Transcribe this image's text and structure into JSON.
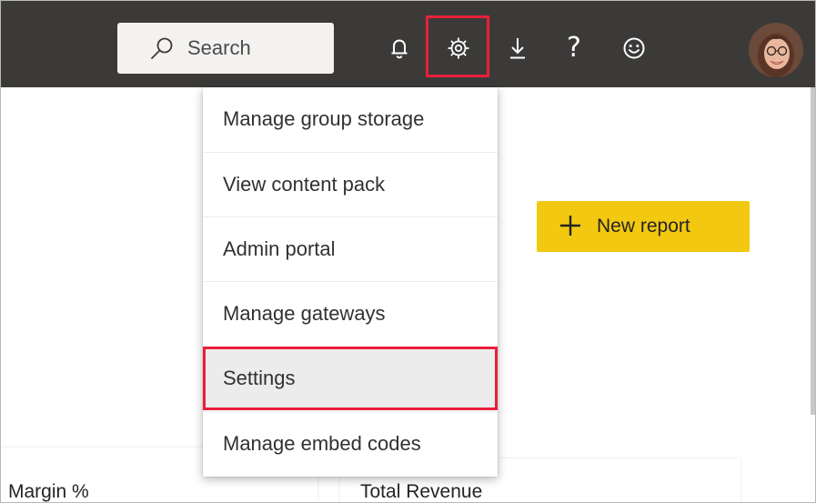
{
  "header": {
    "search": {
      "placeholder": "Search",
      "icon": "search-icon"
    },
    "icons": [
      {
        "name": "notifications-bell-icon"
      },
      {
        "name": "settings-gear-icon",
        "highlighted": true
      },
      {
        "name": "download-icon"
      },
      {
        "name": "help-icon",
        "glyph": "?"
      },
      {
        "name": "feedback-smiley-icon"
      }
    ],
    "avatar": "profile-avatar"
  },
  "settings_menu": {
    "items": [
      {
        "label": "Manage group storage"
      },
      {
        "label": "View content pack"
      },
      {
        "label": "Admin portal"
      },
      {
        "label": "Manage gateways"
      },
      {
        "label": "Settings",
        "highlighted": true
      },
      {
        "label": "Manage embed codes"
      }
    ]
  },
  "toolbar": {
    "new_report_label": "New report"
  },
  "cards": {
    "left_title": "Margin %",
    "right_title": "Total Revenue"
  },
  "colors": {
    "topbar": "#3b3a39",
    "accent_yellow": "#f2c811",
    "highlight_red": "#e8203a"
  }
}
